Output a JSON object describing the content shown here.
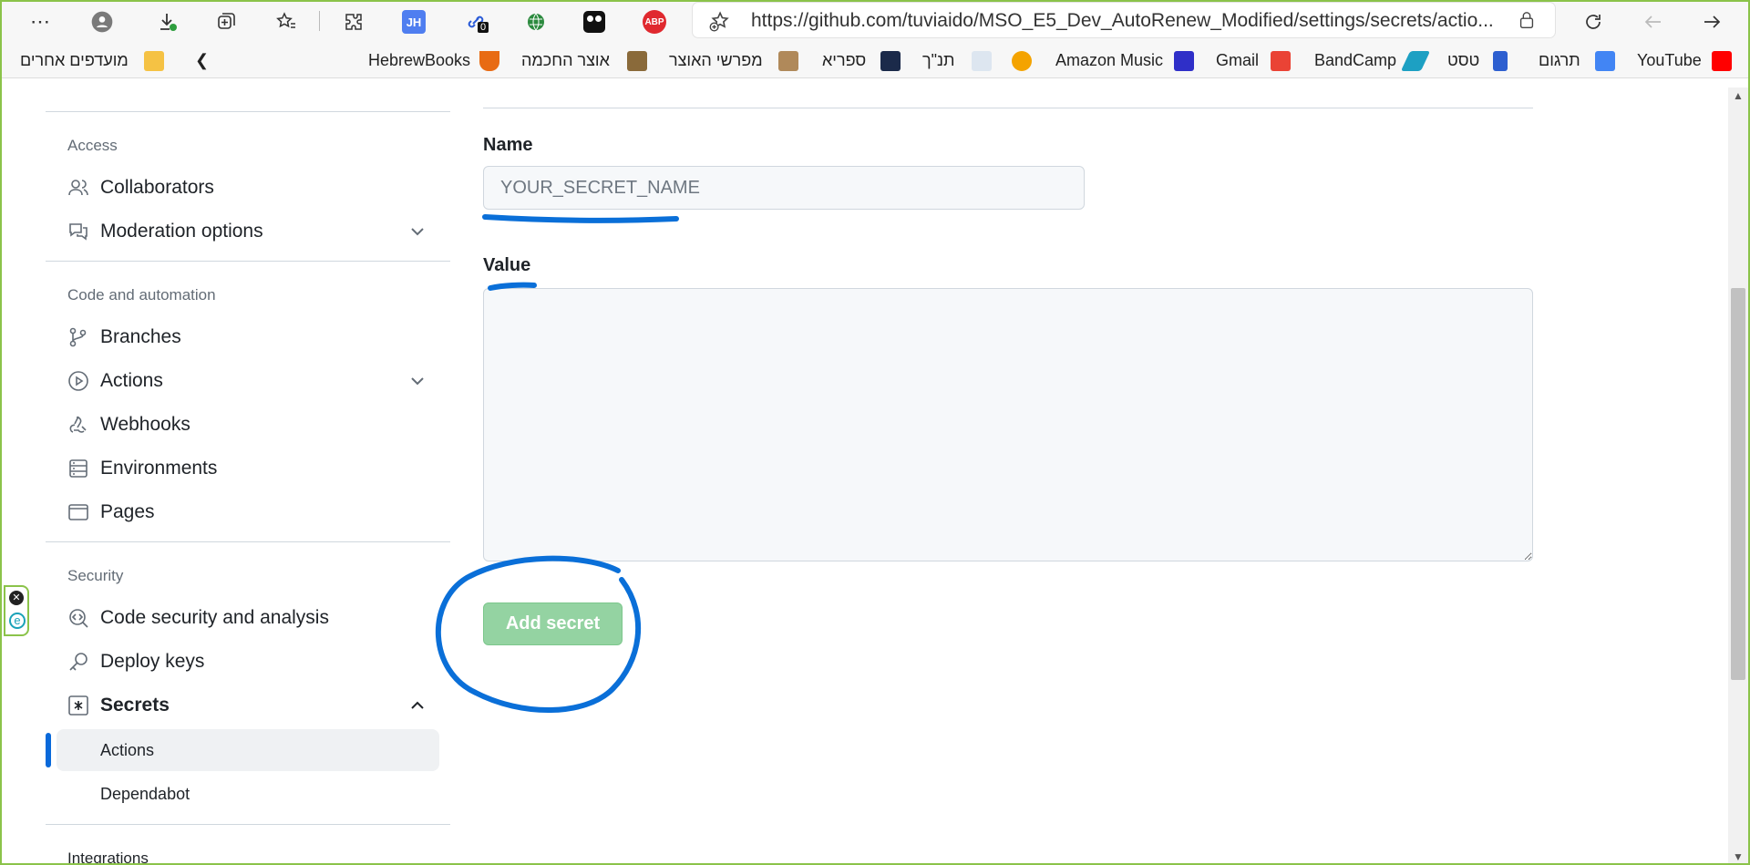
{
  "browser": {
    "url": "https://github.com/tuviaido/MSO_E5_Dev_AutoRenew_Modified/settings/secrets/actio...",
    "extension_badge_count": "0",
    "abp_label": "ABP",
    "jh_label": "JH"
  },
  "bookmarks": {
    "other_favorites": "מועדפים אחרים",
    "items": [
      "YouTube",
      "תרגום",
      "טסט",
      "BandCamp",
      "Gmail",
      "Amazon Music",
      "תנ\"ך",
      "ספריא",
      "מפרשי האוצר",
      "אוצר החכמה",
      "HebrewBooks"
    ]
  },
  "sidebar": {
    "access_heading": "Access",
    "collaborators": "Collaborators",
    "moderation": "Moderation options",
    "code_heading": "Code and automation",
    "branches": "Branches",
    "actions": "Actions",
    "webhooks": "Webhooks",
    "environments": "Environments",
    "pages": "Pages",
    "security_heading": "Security",
    "code_security": "Code security and analysis",
    "deploy_keys": "Deploy keys",
    "secrets": "Secrets",
    "secrets_actions": "Actions",
    "secrets_dependabot": "Dependabot",
    "integrations_heading": "Integrations"
  },
  "form": {
    "name_label": "Name",
    "name_placeholder": "YOUR_SECRET_NAME",
    "value_label": "Value",
    "add_button": "Add secret"
  },
  "colors": {
    "annotation": "#0a6fd8",
    "button_disabled": "#94d3a2",
    "accent": "#0969da"
  }
}
